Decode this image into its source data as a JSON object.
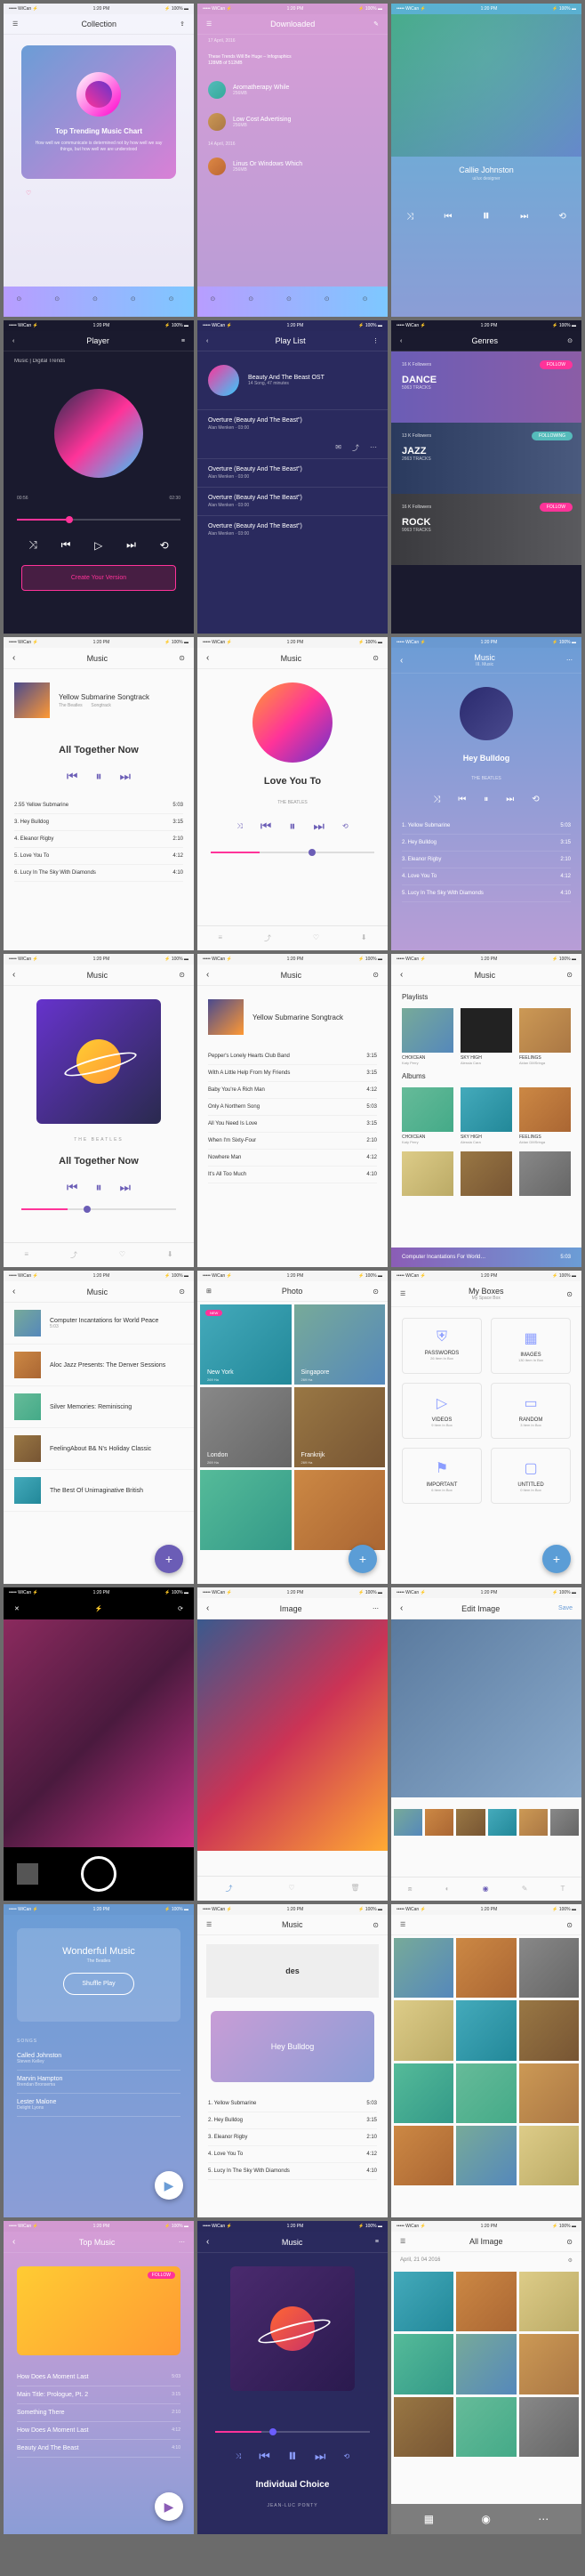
{
  "status": {
    "carrier": "••••• WiCan ⚡",
    "time": "1:20 PM",
    "batt": "⚡ 100% ▬"
  },
  "s1": {
    "title": "Collection",
    "card_title": "Top Trending Music Chart",
    "card_sub": "How well we communicate is determined not by how well we say things, but how well we are understood"
  },
  "s2": {
    "title": "Downloaded",
    "head1": "These Trends Will Be Huge – Infographics",
    "head2": "128MB of 512MB",
    "date1": "17 April, 2016",
    "i1t": "Aromatherapy While",
    "i1s": "256MB",
    "i2t": "Low Cost Advertising",
    "i2s": "256MB",
    "date2": "14 April, 2016",
    "i3t": "Linus Or Windows Which",
    "i3s": "256MB"
  },
  "s3": {
    "name": "Callie Johnston",
    "role": "ui/ux designer"
  },
  "s4": {
    "title": "Player",
    "crumb": "Music | Digital Trends",
    "cta": "Create Your Version",
    "t1": "00:56",
    "t2": "02:30"
  },
  "s5": {
    "title": "Play List",
    "album": "Beauty And The Beast OST",
    "meta": "14 Song, 47 minutes",
    "t1": "Overture (Beauty And The Beast\")",
    "t2": "Overture (Beauty And The Beast\")",
    "t3": "Overture (Beauty And The Beast\")",
    "t4": "Overture (Beauty And The Beast\")",
    "a": "Alan Menken",
    "d": "03:00"
  },
  "s6": {
    "title": "Genres",
    "f1": "16 K Followers",
    "g1": "DANCE",
    "s1": "5063 TRACKS",
    "f2": "13 K Followers",
    "g2": "JAZZ",
    "s2": "2663 TRACKS",
    "f3": "16 K Followers",
    "g3": "ROCK",
    "s3": "9063 TRACKS",
    "btn": "FOLLOW",
    "btn2": "FOLLOWING"
  },
  "s7": {
    "title": "Music",
    "album": "Yellow Submarine Songtrack",
    "sub": "The Beatles",
    "sub2": "Songtrack",
    "now": "All Together Now",
    "tracks": [
      [
        "2.55",
        "Yellow Submarine",
        "5:03"
      ],
      [
        "",
        "3. Hey Bulldog",
        "3:15"
      ],
      [
        "",
        "4. Eleanor Rigby",
        "2:10"
      ],
      [
        "",
        "5. Love You To",
        "4:12"
      ],
      [
        "",
        "6. Lucy In The Sky With Diamonds",
        "4:10"
      ]
    ]
  },
  "s8": {
    "title": "Music",
    "now": "Love You To",
    "artist": "THE BEATLES"
  },
  "s9": {
    "title": "Music",
    "sub": "III. Music",
    "now": "Hey Bulldog",
    "artist": "THE BEATLES",
    "tracks": [
      [
        "1. Yellow Submarine",
        "5:03"
      ],
      [
        "2. Hey Bulldog",
        "3:15"
      ],
      [
        "3. Eleanor Rigby",
        "2:10"
      ],
      [
        "4. Love You To",
        "4:12"
      ],
      [
        "5. Lucy In The Sky With Diamonds",
        "4:10"
      ]
    ]
  },
  "s10": {
    "title": "Music",
    "artist": "THE BEATLES",
    "now": "All Together Now"
  },
  "s11": {
    "title": "Music",
    "album": "Yellow Submarine Songtrack",
    "tracks": [
      [
        "Pepper's Lonely Hearts Club Band",
        "3:15"
      ],
      [
        "With A Little Help From My Friends",
        "3:15"
      ],
      [
        "Baby You're A Rich Man",
        "4:12"
      ],
      [
        "Only A Northern Song",
        "5:03"
      ],
      [
        "All You Need Is Love",
        "3:15"
      ],
      [
        "When I'm Sixty-Four",
        "2:10"
      ],
      [
        "Nowhere Man",
        "4:12"
      ],
      [
        "It's All Too Much",
        "4:10"
      ]
    ]
  },
  "s12": {
    "title": "Music",
    "sec1": "Playlists",
    "sec2": "Albums",
    "t1": "CHOICEAN",
    "s1": "Katy Perry",
    "t2": "SKY HIGH",
    "s2": "Alessia Cara",
    "t3": "FEELINGS",
    "s3": "Aidan DMSringa",
    "np": "Computer Incantations For World…",
    "npd": "5:03"
  },
  "s13": {
    "title": "Music",
    "items": [
      [
        "Computer Incantations for World Peace",
        "5:03"
      ],
      [
        "Aloc Jazz Presents: The Denver Sessions",
        ""
      ],
      [
        "Silver Memories: Reminiscing",
        ""
      ],
      [
        "FeelingAbout B& N's Holiday Classic",
        ""
      ],
      [
        "The Best Of Unimaginative British",
        ""
      ]
    ]
  },
  "s14": {
    "title": "Photo",
    "c1": "New York",
    "c1s": "269 Ha",
    "c2": "Singapore",
    "c2s": "269 Ha",
    "c3": "London",
    "c3s": "269 Ha",
    "c4": "Frankrijk",
    "c4s": "269 Ha",
    "new": "NEW"
  },
  "s15": {
    "title": "My Boxes",
    "sub": "My Space Box",
    "b1": "PASSWORDS",
    "b1s": "26 Item In Box",
    "b2": "IMAGES",
    "b2s": "130 Item In Box",
    "b3": "VIDEOS",
    "b3s": "9 Item In Box",
    "b4": "RANDOM",
    "b4s": "3 Item In Box",
    "b5": "IMPORTANT",
    "b5s": "6 Item In Box",
    "b6": "UNTITLED",
    "b6s": "0 Item In Box"
  },
  "s17": {
    "title": "Image"
  },
  "s18": {
    "title": "Edit Image",
    "save": "Save"
  },
  "s19": {
    "hero": "Wonderful Music",
    "sub": "The Beatles",
    "btn": "Shuffle Play",
    "label": "SONGS",
    "i1": "Called Johnston",
    "i1s": "Steven Kelley",
    "i2": "Marvin Hampton",
    "i2s": "Brendan Bronsema",
    "i3": "Lester Malone",
    "i3s": "Delight Lyons"
  },
  "s20": {
    "title": "Music",
    "big": "Hey Bulldog",
    "tracks": [
      [
        "1. Yellow Submarine",
        "5:03"
      ],
      [
        "2. Hey Bulldog",
        "3:15"
      ],
      [
        "3. Eleanor Rigby",
        "2:10"
      ],
      [
        "4. Love You To",
        "4:12"
      ],
      [
        "5. Lucy In The Sky With Diamonds",
        "4:10"
      ]
    ]
  },
  "s22": {
    "title": "Top Music",
    "tracks": [
      [
        "How Does A Moment Last",
        "5:03"
      ],
      [
        "Main Title: Prologue, Pt. 2",
        "3:15"
      ],
      [
        "Something There",
        "2:10"
      ],
      [
        "How Does A Moment Last",
        "4:12"
      ],
      [
        "Beauty And The Beast",
        "4:10"
      ]
    ]
  },
  "s23": {
    "title": "Music",
    "now": "Individual Choice",
    "artist": "JEAN-LUC PONTY"
  },
  "s24": {
    "title": "All Image",
    "date": "April, 21 04 2016"
  }
}
